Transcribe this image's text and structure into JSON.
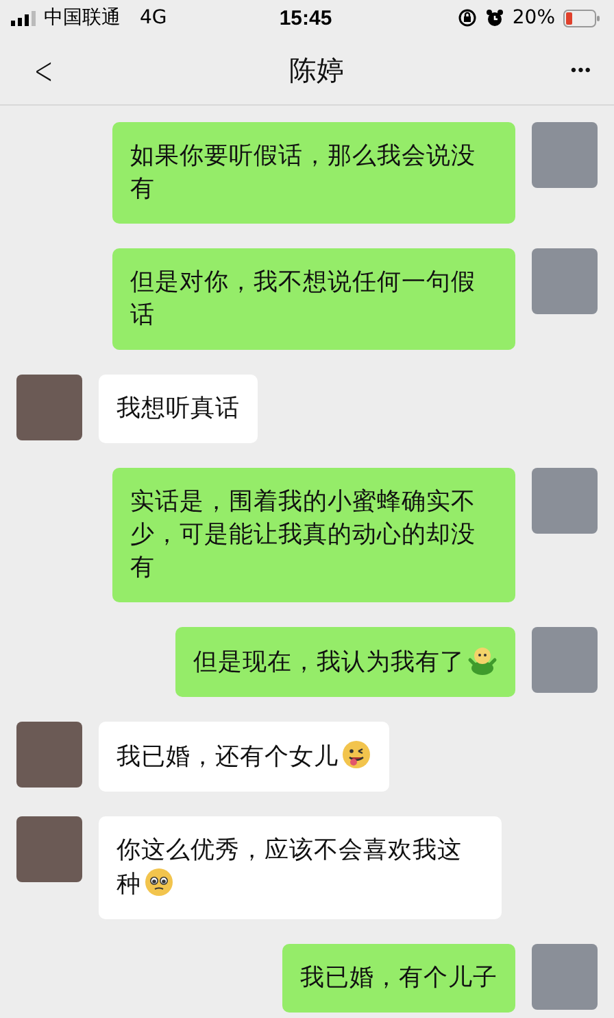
{
  "status_bar": {
    "carrier": "中国联通",
    "network": "4G",
    "time": "15:45",
    "battery": "20%"
  },
  "nav_bar": {
    "back": "<",
    "title": "陈婷",
    "more": "•••"
  },
  "messages": [
    {
      "kind": "sent",
      "text": "如果你要听假话，那么我会说没有"
    },
    {
      "kind": "sent",
      "text": "但是对你，我不想说任何一句假话"
    },
    {
      "kind": "received",
      "text": "我想听真话"
    },
    {
      "kind": "sent",
      "text": "实话是，围着我的小蜜蜂确实不少，可是能让我真的动心的却没有"
    },
    {
      "kind": "sent",
      "text": "但是现在，我认为我有了",
      "emoji": {
        "kind": "sprout"
      }
    },
    {
      "kind": "received",
      "text": "我已婚，还有个女儿",
      "emoji": {
        "kind": "wink"
      }
    },
    {
      "kind": "received",
      "text": "你这么优秀，应该不会喜欢我这种",
      "emoji": {
        "kind": "pleading"
      }
    },
    {
      "kind": "sent",
      "text": "我已婚，有个儿子"
    }
  ]
}
